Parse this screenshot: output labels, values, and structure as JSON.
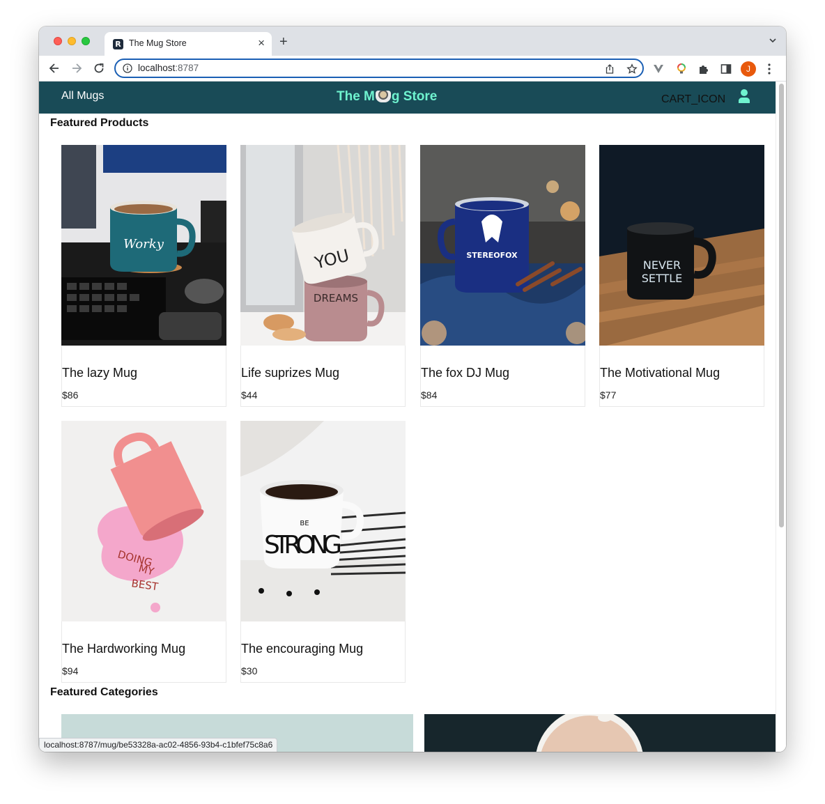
{
  "browser": {
    "tab_title": "The Mug Store",
    "new_tab": "+",
    "close_tab": "×",
    "url_host": "localhost",
    "url_port": ":8787",
    "profile_initial": "J",
    "status_url": "localhost:8787/mug/be53328a-ac02-4856-93b4-c1bfef75c8a6",
    "colors": {
      "focus_ring": "#1a5fb4",
      "tabstrip": "#dee1e6",
      "profile": "#e8590c"
    }
  },
  "header": {
    "nav_link": "All Mugs",
    "brand_left": "The M",
    "brand_right": "g Store",
    "cart_label": "CART_ICON",
    "colors": {
      "background": "#194b57",
      "brand": "#6ff3cf",
      "user_icon": "#6ff3cf"
    }
  },
  "featured_products": {
    "title": "Featured Products",
    "items": [
      {
        "name": "The lazy Mug",
        "price": "$86",
        "image_icon": "teal-mug-on-desk-photo"
      },
      {
        "name": "Life suprizes Mug",
        "price": "$44",
        "image_icon": "stacked-mugs-photo"
      },
      {
        "name": "The fox DJ Mug",
        "price": "$84",
        "image_icon": "blue-enamel-mug-photo"
      },
      {
        "name": "The Motivational Mug",
        "price": "$77",
        "image_icon": "black-mug-on-wood-photo"
      },
      {
        "name": "The Hardworking Mug",
        "price": "$94",
        "image_icon": "spilled-pink-mug-photo"
      },
      {
        "name": "The encouraging Mug",
        "price": "$30",
        "image_icon": "white-strong-mug-photo"
      }
    ]
  },
  "featured_categories": {
    "title": "Featured Categories"
  }
}
